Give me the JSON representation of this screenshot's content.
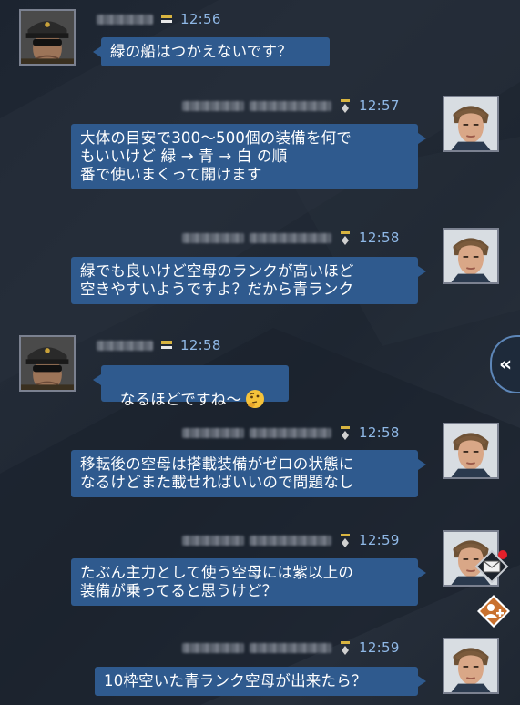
{
  "messages": [
    {
      "side": "left",
      "sender": "commander",
      "time": "12:56",
      "lines": "緑の船はつかえないです？"
    },
    {
      "side": "right",
      "sender": "player",
      "time": "12:57",
      "lines": "大体の目安で300～500個の装備を何で\nもいいけど 緑 → 青 → 白 の順\n番で使いまくって開けます"
    },
    {
      "side": "right",
      "sender": "player",
      "time": "12:58",
      "lines": "緑でも良いけど空母のランクが高いほど\n空きやすいようですよ？だから青ランク"
    },
    {
      "side": "left",
      "sender": "commander",
      "time": "12:58",
      "lines": "なるほどですね～"
    },
    {
      "side": "right",
      "sender": "player",
      "time": "12:58",
      "lines": "移転後の空母は搭載装備がゼロの状態に\nなるけどまた載せればいいので問題なし"
    },
    {
      "side": "right",
      "sender": "player",
      "time": "12:59",
      "lines": "たぶん主力として使う空母には紫以上の\n装備が乗ってると思うけど？"
    },
    {
      "side": "right",
      "sender": "player",
      "time": "12:59",
      "lines": "10枠空いた青ランク空母が出来たら？"
    }
  ],
  "emoji": {
    "name": "thinking-face-icon"
  },
  "side_tab": {
    "icon": "double-chevron-left-icon",
    "label": "«"
  },
  "floating_buttons": [
    {
      "name": "mail-notification-icon"
    },
    {
      "name": "add-friend-icon"
    }
  ],
  "colors": {
    "bubble": "#2f5a8e",
    "time_text": "#8fb8e6",
    "background": "#1f2732",
    "notification_dot": "#e5202a",
    "friend_button": "#c9712e"
  }
}
